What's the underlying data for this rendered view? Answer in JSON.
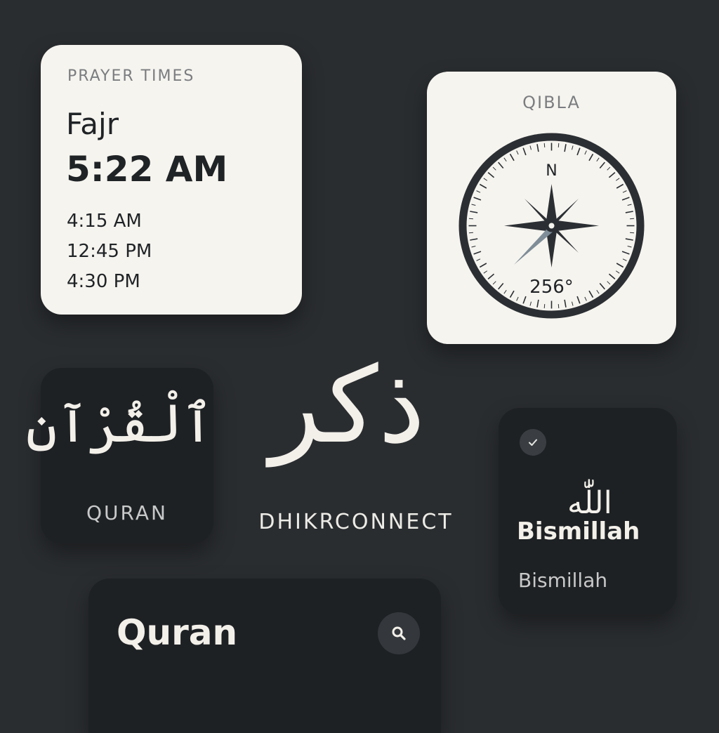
{
  "prayer_widget": {
    "label": "PRAYER TIMES",
    "current_prayer": "Fajr",
    "current_time": "5:22 AM",
    "other_times": [
      "4:15 AM",
      "12:45 PM",
      "4:30 PM"
    ]
  },
  "qibla_widget": {
    "label": "QIBLA",
    "north_label": "N",
    "bearing": "256°",
    "bearing_degrees": 256
  },
  "quran_tile": {
    "arabic": "ٱلْقُرْآن",
    "label": "QURAN"
  },
  "app": {
    "logo_arabic": "ذكر",
    "name": "DHIKRCONNECT"
  },
  "bismillah_card": {
    "check_icon": "check-icon",
    "arabic": "اللّٰه",
    "title": "Bismillah",
    "subtitle": "Bismillah"
  },
  "quran_header": {
    "title": "Quran",
    "search_icon": "search-icon"
  },
  "colors": {
    "background": "#2a2d30",
    "card_light": "#f6f4ef",
    "card_dark": "#1e2124",
    "accent_needle": "#7f8d98"
  }
}
